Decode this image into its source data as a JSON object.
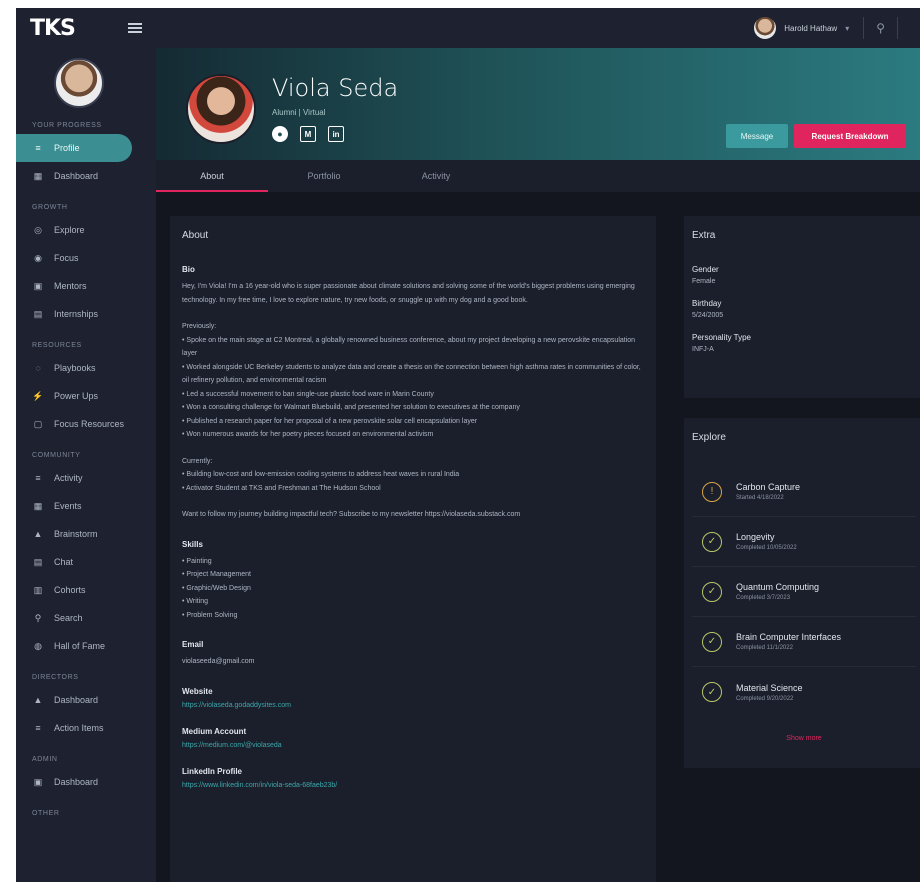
{
  "brand": {
    "logo": "TKS"
  },
  "sidebar": {
    "sections": [
      {
        "title": "Your Progress",
        "items": [
          {
            "label": "Profile",
            "icon": "user-icon",
            "glyph": "≡",
            "active": true
          },
          {
            "label": "Dashboard",
            "icon": "grid-icon",
            "glyph": "▦"
          }
        ]
      },
      {
        "title": "Growth",
        "items": [
          {
            "label": "Explore",
            "icon": "compass-icon",
            "glyph": "◎"
          },
          {
            "label": "Focus",
            "icon": "target-icon",
            "glyph": "◉"
          },
          {
            "label": "Mentors",
            "icon": "mentor-icon",
            "glyph": "▣"
          },
          {
            "label": "Internships",
            "icon": "briefcase-icon",
            "glyph": "▤"
          }
        ]
      },
      {
        "title": "Resources",
        "items": [
          {
            "label": "Playbooks",
            "icon": "book-icon",
            "glyph": "◌"
          },
          {
            "label": "Power Ups",
            "icon": "bolt-icon",
            "glyph": "⚡"
          },
          {
            "label": "Focus Resources",
            "icon": "folder-icon",
            "glyph": "▢"
          }
        ]
      },
      {
        "title": "Community",
        "items": [
          {
            "label": "Activity",
            "icon": "activity-icon",
            "glyph": "≡"
          },
          {
            "label": "Events",
            "icon": "calendar-icon",
            "glyph": "▦"
          },
          {
            "label": "Brainstorm",
            "icon": "bulb-icon",
            "glyph": "▲"
          },
          {
            "label": "Chat",
            "icon": "chat-icon",
            "glyph": "▤"
          },
          {
            "label": "Cohorts",
            "icon": "cohort-icon",
            "glyph": "▥"
          },
          {
            "label": "Search",
            "icon": "search-icon",
            "glyph": "⚲"
          },
          {
            "label": "Hall of Fame",
            "icon": "trophy-icon",
            "glyph": "◍"
          }
        ]
      },
      {
        "title": "Directors",
        "items": [
          {
            "label": "Dashboard",
            "icon": "chart-icon",
            "glyph": "▲"
          },
          {
            "label": "Action Items",
            "icon": "checklist-icon",
            "glyph": "≡"
          }
        ]
      },
      {
        "title": "Admin",
        "items": [
          {
            "label": "Dashboard",
            "icon": "admin-icon",
            "glyph": "▣"
          }
        ]
      },
      {
        "title": "Other",
        "items": []
      }
    ]
  },
  "topbar": {
    "user_name": "Harold Hathaw"
  },
  "profile": {
    "name": "Viola Seda",
    "role": "Alumni | Virtual",
    "tabs": [
      {
        "label": "About",
        "active": true
      },
      {
        "label": "Portfolio"
      },
      {
        "label": "Activity"
      }
    ],
    "buttons": {
      "message": "Message",
      "breakdown": "Request Breakdown"
    }
  },
  "about": {
    "title": "About",
    "bio_label": "Bio",
    "bio": "Hey, I'm Viola! I'm a 16 year-old who is super passionate about climate solutions and solving some of the world's biggest problems using emerging technology. In my free time, I love to explore nature, try new foods, or snuggle up with my dog and a good book.",
    "previously_label": "Previously:",
    "previously": [
      "• Spoke on the main stage at C2 Montreal, a globally renowned business conference, about my project developing a new perovskite encapsulation layer",
      "• Worked alongside UC Berkeley students to analyze data and create a thesis on the connection between high asthma rates in communities of color, oil refinery pollution, and environmental racism",
      "• Led a successful movement to ban single-use plastic food ware in Marin County",
      "• Won a consulting challenge for Walmart Bluebuild, and presented her solution to executives at the company",
      "• Published a research paper for her proposal of a new perovskite solar cell encapsulation layer",
      "• Won numerous awards for her poetry pieces focused on environmental activism"
    ],
    "currently_label": "Currently:",
    "currently": [
      "• Building low-cost and low-emission cooling systems to address heat waves in rural India",
      "• Activator Student at TKS and Freshman at The Hudson School"
    ],
    "newsletter": "Want to follow my journey building impactful tech? Subscribe to my newsletter https://violaseda.substack.com",
    "skills_label": "Skills",
    "skills": [
      "• Painting",
      "• Project Management",
      "• Graphic/Web Design",
      "• Writing",
      "• Problem Solving"
    ],
    "email_label": "Email",
    "email": "violaseeda@gmail.com",
    "website_label": "Website",
    "website": "https://violaseda.godaddysites.com",
    "medium_label": "Medium Account",
    "medium": "https://medium.com/@violaseda",
    "linkedin_label": "LinkedIn Profile",
    "linkedin": "https://www.linkedin.com/in/viola-seda-68faeb23b/"
  },
  "extra": {
    "title": "Extra",
    "fields": [
      {
        "label": "Gender",
        "value": "Female"
      },
      {
        "label": "Birthday",
        "value": "5/24/2005"
      },
      {
        "label": "Personality Type",
        "value": "INFJ-A"
      }
    ]
  },
  "explore": {
    "title": "Explore",
    "items": [
      {
        "title": "Carbon Capture",
        "sub": "Started 4/18/2022",
        "status": "in-progress"
      },
      {
        "title": "Longevity",
        "sub": "Completed 10/05/2022",
        "status": "done"
      },
      {
        "title": "Quantum Computing",
        "sub": "Completed 3/7/2023",
        "status": "done"
      },
      {
        "title": "Brain Computer Interfaces",
        "sub": "Completed 11/1/2022",
        "status": "done"
      },
      {
        "title": "Material Science",
        "sub": "Completed 9/20/2022",
        "status": "done"
      }
    ],
    "show_more": "Show more"
  },
  "colors": {
    "accent": "#3b9a9d",
    "primary_action": "#e0245e",
    "sidebar_bg": "#1e2230",
    "main_bg": "#13161f",
    "card_bg": "#1b1f2b"
  }
}
